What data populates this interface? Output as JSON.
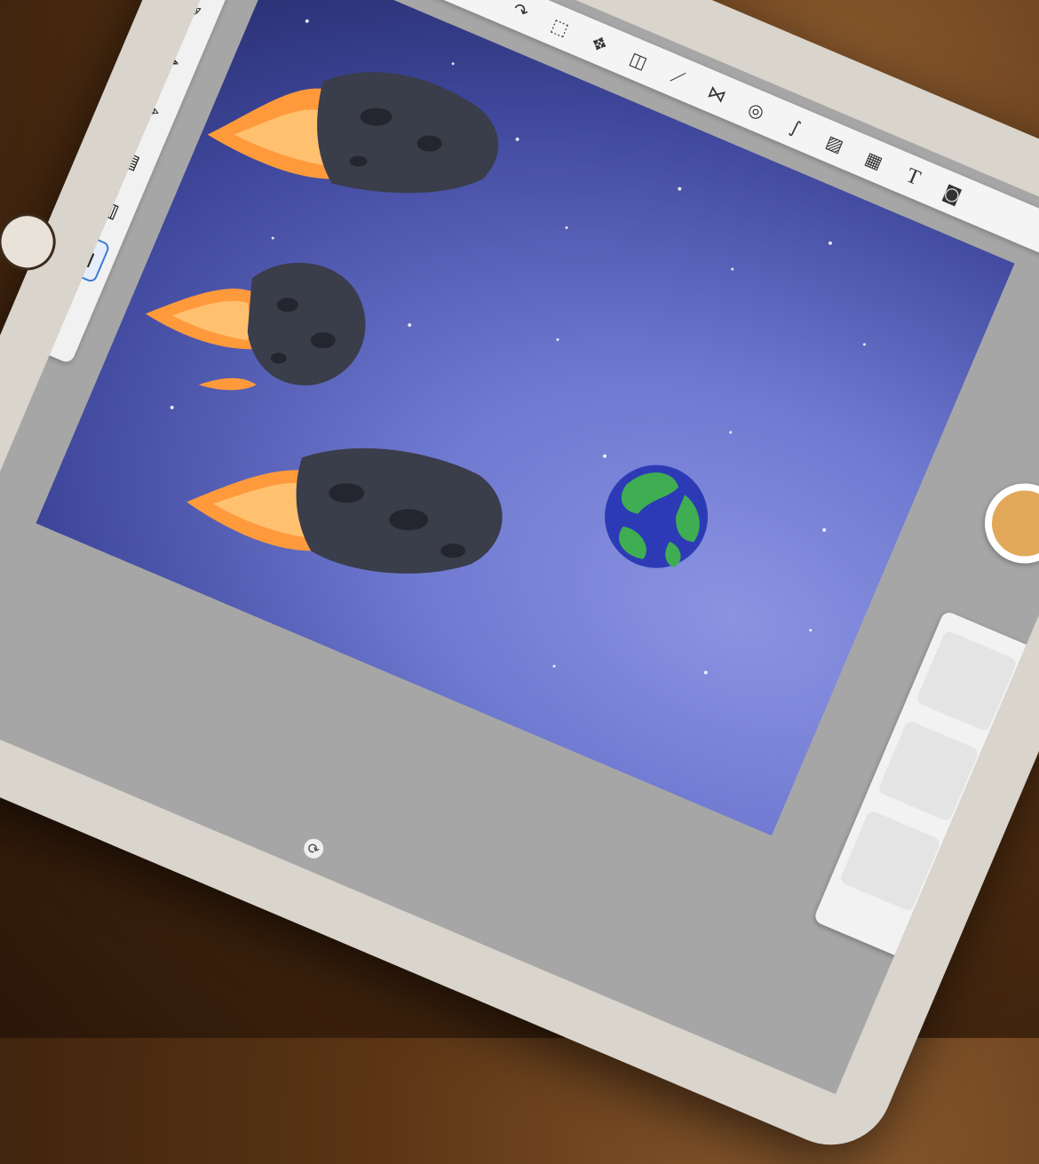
{
  "app": {
    "toolbar_icons": [
      "layers-menu-icon",
      "undo-icon",
      "redo-icon",
      "selection-icon",
      "transform-icon",
      "fill-bucket-icon",
      "ruler-icon",
      "symmetry-icon",
      "shapes-icon",
      "curve-icon",
      "image-import-icon",
      "perspective-grid-icon",
      "text-icon",
      "record-icon"
    ],
    "text_tool_label": "T",
    "brushes": [
      "airbrush-icon",
      "paintbrush-icon",
      "marker-icon",
      "pen-icon",
      "pencil-icon",
      "texture-brush-icon",
      "hatch-brush-icon",
      "fill-brush-icon"
    ],
    "active_brush_index": 7
  },
  "colors": {
    "current_color": "#e2a85a",
    "canvas_top": "#262c6b",
    "canvas_glow": "#8b93e2",
    "fire": "#ff9a3c",
    "asteroid": "#3a3d4a",
    "earth_ocean": "#2c3bb5",
    "earth_land": "#3fae52"
  }
}
